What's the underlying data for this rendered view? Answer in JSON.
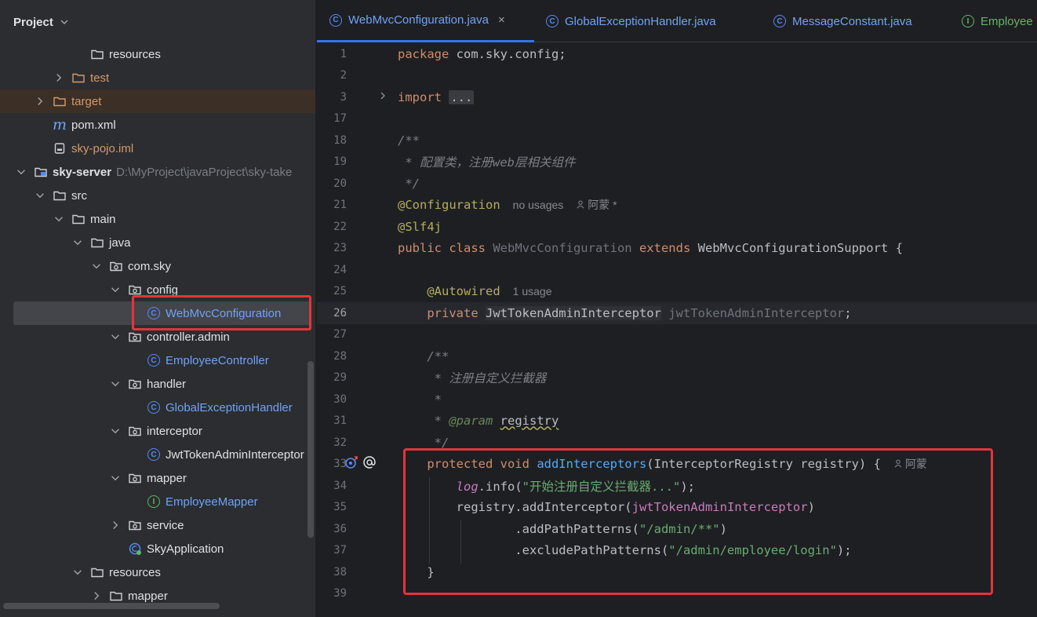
{
  "project_panel": {
    "title": "Project",
    "tree": [
      {
        "label": "resources",
        "icon": "folder-icon",
        "color": "#dfe1e5",
        "arrow": "none"
      },
      {
        "label": "test",
        "icon": "folder-icon",
        "color": "#d49a6a",
        "arrow": "collapsed"
      },
      {
        "label": "target",
        "icon": "folder-icon",
        "color": "#d49a6a",
        "arrow": "collapsed"
      },
      {
        "label": "pom.xml",
        "icon": "maven-icon",
        "color": "#dfe1e5",
        "arrow": "none"
      },
      {
        "label": "sky-pojo.iml",
        "icon": "file-icon",
        "color": "#d49a6a",
        "arrow": "none"
      },
      {
        "label": "sky-server",
        "hint": "D:\\MyProject\\javaProject\\sky-take",
        "icon": "module-icon",
        "color": "#dfe1e5",
        "arrow": "expanded"
      },
      {
        "label": "src",
        "icon": "folder-icon",
        "color": "#dfe1e5",
        "arrow": "expanded"
      },
      {
        "label": "main",
        "icon": "folder-icon",
        "color": "#dfe1e5",
        "arrow": "expanded"
      },
      {
        "label": "java",
        "icon": "folder-icon",
        "color": "#dfe1e5",
        "arrow": "expanded"
      },
      {
        "label": "com.sky",
        "icon": "package-icon",
        "color": "#dfe1e5",
        "arrow": "expanded"
      },
      {
        "label": "config",
        "icon": "package-icon",
        "color": "#dfe1e5",
        "arrow": "expanded"
      },
      {
        "label": "WebMvcConfiguration",
        "icon": "class-icon",
        "color": "#6fa3f7",
        "arrow": "none",
        "selected": true
      },
      {
        "label": "controller.admin",
        "icon": "package-icon",
        "color": "#dfe1e5",
        "arrow": "expanded"
      },
      {
        "label": "EmployeeController",
        "icon": "class-icon",
        "color": "#6fa3f7",
        "arrow": "none"
      },
      {
        "label": "handler",
        "icon": "package-icon",
        "color": "#dfe1e5",
        "arrow": "expanded"
      },
      {
        "label": "GlobalExceptionHandler",
        "icon": "class-icon",
        "color": "#6fa3f7",
        "arrow": "none"
      },
      {
        "label": "interceptor",
        "icon": "package-icon",
        "color": "#dfe1e5",
        "arrow": "expanded"
      },
      {
        "label": "JwtTokenAdminInterceptor",
        "icon": "class-icon",
        "color": "#dfe1e5",
        "arrow": "none"
      },
      {
        "label": "mapper",
        "icon": "package-icon",
        "color": "#dfe1e5",
        "arrow": "expanded"
      },
      {
        "label": "EmployeeMapper",
        "icon": "interface-icon",
        "color": "#6fa3f7",
        "arrow": "none"
      },
      {
        "label": "service",
        "icon": "package-icon",
        "color": "#dfe1e5",
        "arrow": "collapsed"
      },
      {
        "label": "SkyApplication",
        "icon": "spring-class-icon",
        "color": "#dfe1e5",
        "arrow": "none"
      },
      {
        "label": "resources",
        "icon": "folder-icon",
        "color": "#dfe1e5",
        "arrow": "expanded"
      },
      {
        "label": "mapper",
        "icon": "folder-icon",
        "color": "#dfe1e5",
        "arrow": "collapsed"
      }
    ]
  },
  "tabs": [
    {
      "label": "WebMvcConfiguration.java",
      "icon": "class-icon",
      "active": true,
      "close": "×"
    },
    {
      "label": "GlobalExceptionHandler.java",
      "icon": "class-icon"
    },
    {
      "label": "MessageConstant.java",
      "icon": "class-icon"
    },
    {
      "label": "Employee",
      "icon": "interface-icon"
    }
  ],
  "editor": {
    "current_line": "26",
    "lines": [
      {
        "n": "1",
        "tokens": [
          [
            "kw",
            "package "
          ],
          [
            "t",
            "com.sky.config;"
          ]
        ]
      },
      {
        "n": "2",
        "tokens": []
      },
      {
        "n": "3",
        "tokens": [
          [
            "kw",
            "import "
          ],
          [
            "fold",
            "..."
          ]
        ]
      },
      {
        "n": "17",
        "tokens": []
      },
      {
        "n": "18",
        "tokens": [
          [
            "cmt",
            "/**"
          ]
        ]
      },
      {
        "n": "19",
        "tokens": [
          [
            "cmt",
            " * 配置类，注册web层相关组件"
          ]
        ]
      },
      {
        "n": "20",
        "tokens": [
          [
            "cmt",
            " */"
          ]
        ]
      },
      {
        "n": "21",
        "tokens": [
          [
            "ann",
            "@Configuration"
          ],
          [
            "hint",
            "no usages"
          ],
          [
            "user",
            "阿蒙 *"
          ]
        ]
      },
      {
        "n": "22",
        "tokens": [
          [
            "ann",
            "@Slf4j"
          ]
        ]
      },
      {
        "n": "23",
        "tokens": [
          [
            "kw",
            "public class "
          ],
          [
            "gray",
            "WebMvcConfiguration "
          ],
          [
            "kw",
            "extends "
          ],
          [
            "t",
            "WebMvcConfigurationSupport {"
          ]
        ]
      },
      {
        "n": "24",
        "tokens": []
      },
      {
        "n": "25",
        "tokens": [
          [
            "t",
            "    "
          ],
          [
            "ann",
            "@Autowired"
          ],
          [
            "hint",
            "1 usage"
          ]
        ]
      },
      {
        "n": "26",
        "tokens": [
          [
            "t",
            "    "
          ],
          [
            "kw",
            "private "
          ],
          [
            "hltype",
            "JwtTokenAdminInterceptor"
          ],
          [
            "t",
            " "
          ],
          [
            "gray",
            "jwtTokenAdminInterceptor"
          ],
          [
            "t",
            ";"
          ]
        ]
      },
      {
        "n": "27",
        "tokens": []
      },
      {
        "n": "28",
        "tokens": [
          [
            "cmt",
            "    /**"
          ]
        ]
      },
      {
        "n": "29",
        "tokens": [
          [
            "cmt",
            "     * 注册自定义拦截器"
          ]
        ]
      },
      {
        "n": "30",
        "tokens": [
          [
            "cmt",
            "     *"
          ]
        ]
      },
      {
        "n": "31",
        "tokens": [
          [
            "cmt",
            "     * "
          ],
          [
            "doctag",
            "@param "
          ],
          [
            "under",
            "registry"
          ]
        ]
      },
      {
        "n": "32",
        "tokens": [
          [
            "cmt",
            "     */"
          ]
        ]
      },
      {
        "n": "33",
        "tokens": [
          [
            "t",
            "    "
          ],
          [
            "kw",
            "protected void "
          ],
          [
            "fn",
            "addInterceptors"
          ],
          [
            "t",
            "(InterceptorRegistry registry) {"
          ],
          [
            "user",
            "阿蒙"
          ]
        ]
      },
      {
        "n": "34",
        "tokens": [
          [
            "t",
            "        "
          ],
          [
            "fldit",
            "log"
          ],
          [
            "t",
            ".info("
          ],
          [
            "str",
            "\"开始注册自定义拦截器...\""
          ],
          [
            "t",
            ");"
          ]
        ]
      },
      {
        "n": "35",
        "tokens": [
          [
            "t",
            "        registry.addInterceptor("
          ],
          [
            "fld",
            "jwtTokenAdminInterceptor"
          ],
          [
            "t",
            ")"
          ]
        ]
      },
      {
        "n": "36",
        "tokens": [
          [
            "t",
            "                .addPathPatterns("
          ],
          [
            "str",
            "\"/admin/**\""
          ],
          [
            "t",
            ")"
          ]
        ]
      },
      {
        "n": "37",
        "tokens": [
          [
            "t",
            "                .excludePathPatterns("
          ],
          [
            "str",
            "\"/admin/employee/login\""
          ],
          [
            "t",
            ");"
          ]
        ]
      },
      {
        "n": "38",
        "tokens": [
          [
            "t",
            "    }"
          ]
        ]
      },
      {
        "n": "39",
        "tokens": []
      }
    ]
  }
}
